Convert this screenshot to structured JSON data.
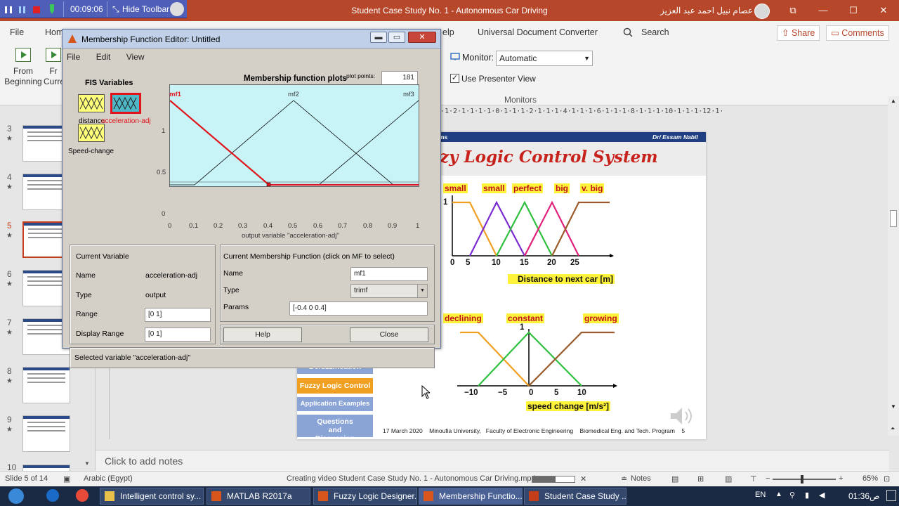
{
  "recorder": {
    "time": "00:09:06",
    "hide_toolbar": "Hide Toolbar"
  },
  "powerpoint": {
    "title": "Student Case Study No. 1 - Autonomous Car Driving",
    "user": "د. عصام نبيل احمد عبد العزيز",
    "window_buttons": {
      "ribbon": "⧉",
      "minimize": "—",
      "maximize": "☐",
      "close": "✕"
    },
    "ribbon": {
      "tabs": [
        "File",
        "Hom",
        "elp"
      ],
      "udc": "Universal Document Converter",
      "search": "Search",
      "share": "Share",
      "comments": "Comments",
      "from_beginning": [
        "From",
        "Beginning"
      ],
      "from_current": [
        "Fr",
        "Curre"
      ],
      "monitor_label": "Monitor:",
      "monitor_value": "Automatic",
      "presenter_view": "Use Presenter View",
      "monitors_group": "Monitors"
    },
    "thumbnails": [
      {
        "num": "3",
        "star": "★"
      },
      {
        "num": "4",
        "star": "★"
      },
      {
        "num": "5",
        "star": "★",
        "active": true
      },
      {
        "num": "6",
        "star": "★"
      },
      {
        "num": "7",
        "star": "★"
      },
      {
        "num": "8",
        "star": "★"
      },
      {
        "num": "9",
        "star": "★"
      },
      {
        "num": "10"
      }
    ],
    "ruler": "·1·2·1·1·1·1·0·1·1·1·2·1·1·1·4·1·1·1·6·1·1·1·8·1·1·1·10·1·1·1·12·1·",
    "notes_placeholder": "Click to add notes",
    "status": {
      "slide": "Slide 5 of 14",
      "language": "Arabic (Egypt)",
      "creating": "Creating video Student Case Study No. 1 - Autonomous Car Driving.mp4",
      "progress": 0.55,
      "notes": "Notes",
      "zoom": "65%"
    }
  },
  "slide": {
    "banner_left": "ms",
    "banner_right": "Dr/ Essam Nabil",
    "title": "zzy Logic Control System",
    "top_labels": [
      "small",
      "small",
      "perfect",
      "big",
      "v. big"
    ],
    "top_ticks": [
      "0",
      "5",
      "10",
      "15",
      "20",
      "25"
    ],
    "top_y1": "1",
    "top_xlabel": "Distance to next car [m]",
    "bottom_labels": [
      "declining",
      "constant",
      "growing"
    ],
    "bottom_ticks": [
      "−10",
      "−5",
      "0",
      "5",
      "10"
    ],
    "bottom_y1": "1",
    "bottom_xlabel": "speed change [m/s²]",
    "side_menu": [
      {
        "label": "Defuzzification",
        "active": false
      },
      {
        "label": "Fuzzy Logic Control",
        "active": true
      },
      {
        "label": "Application Examples",
        "active": false
      },
      {
        "label": "Questions and Discussion",
        "active": false
      }
    ],
    "footer": {
      "date": "17 March 2020",
      "univ": "Minoufia University,",
      "faculty": "Faculty of Electronic Engineering",
      "program": "Biomedical Eng. and Tech. Program",
      "page": "5"
    }
  },
  "mf_editor": {
    "title": "Membership Function Editor: Untitled",
    "menu": [
      "File",
      "Edit",
      "View"
    ],
    "fis_variables_label": "FIS Variables",
    "variables": [
      "distance",
      "acceleration-adj",
      "Speed-change"
    ],
    "plot_title": "Membership function plots",
    "plot_points_label": "plot points:",
    "plot_points": "181",
    "mf_names": [
      "mf1",
      "mf2",
      "mf3"
    ],
    "x_ticks": [
      "0",
      "0.1",
      "0.2",
      "0.3",
      "0.4",
      "0.5",
      "0.6",
      "0.7",
      "0.8",
      "0.9",
      "1"
    ],
    "y_ticks": [
      "1",
      "0.5",
      "0"
    ],
    "x_label": "output variable \"acceleration-adj\"",
    "current_variable": {
      "header": "Current Variable",
      "name_label": "Name",
      "name_value": "acceleration-adj",
      "type_label": "Type",
      "type_value": "output",
      "range_label": "Range",
      "range_value": "[0 1]",
      "display_range_label": "Display Range",
      "display_range_value": "[0 1]"
    },
    "current_mf": {
      "header": "Current Membership Function (click on MF to select)",
      "name_label": "Name",
      "name_value": "mf1",
      "type_label": "Type",
      "type_value": "trimf",
      "params_label": "Params",
      "params_value": "[-0.4 0 0.4]"
    },
    "help": "Help",
    "close": "Close",
    "status": "Selected variable \"acceleration-adj\""
  },
  "taskbar": {
    "items": [
      {
        "label": "Intelligent control sy...",
        "color": "#e8c14a"
      },
      {
        "label": "MATLAB R2017a",
        "color": "#d8551c"
      },
      {
        "label": "Fuzzy Logic Designer...",
        "color": "#d8551c"
      },
      {
        "label": "Membership Functio...",
        "color": "#d8551c",
        "active": true
      },
      {
        "label": "Student Case Study ...",
        "color": "#c43e1c"
      }
    ],
    "lang": "EN",
    "time": "01:36",
    "ampm": "ص"
  }
}
